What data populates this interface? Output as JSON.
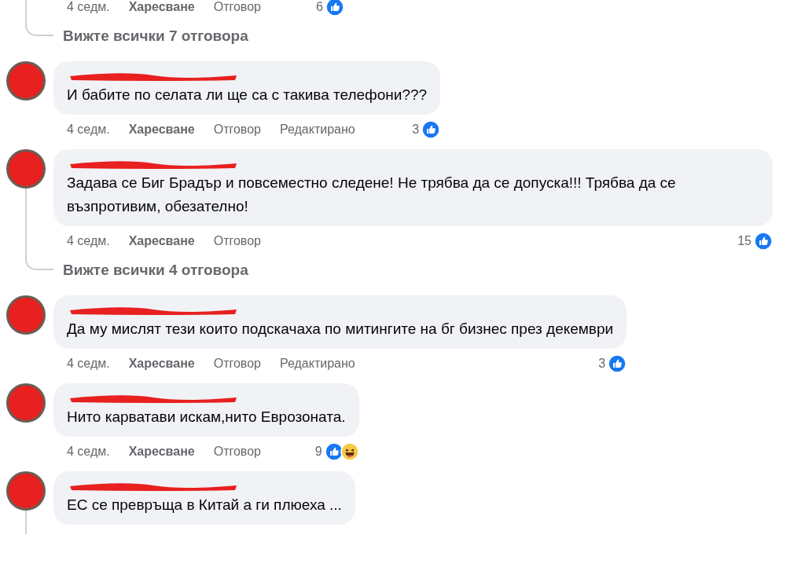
{
  "top_actions": {
    "time": "4 седм.",
    "like": "Харесване",
    "reply": "Отговор",
    "count": "6",
    "reactions": [
      {
        "kind": "like"
      }
    ]
  },
  "top_view_replies": "Вижте всички 7 отговора",
  "comments": [
    {
      "text": "И бабите по селата ли ще са с такива телефони???",
      "has_replies": false,
      "actions": {
        "time": "4 седм.",
        "like": "Харесване",
        "reply": "Отговор",
        "edited": "Редактирано",
        "count": "3",
        "reactions": [
          {
            "kind": "like"
          }
        ]
      }
    },
    {
      "text": "Задава се Биг Брадър и повсеместно следене! Не трябва да се допуска!!! Трябва да се възпротивим, обезателно!",
      "has_replies": true,
      "actions": {
        "time": "4 седм.",
        "like": "Харесване",
        "reply": "Отговор",
        "count": "15",
        "reactions": [
          {
            "kind": "like"
          }
        ]
      },
      "view_replies": "Вижте всички 4 отговора"
    },
    {
      "text": "Да му мислят тези които подскачаха по митингите на бг бизнес през декември",
      "has_replies": false,
      "actions": {
        "time": "4 седм.",
        "like": "Харесване",
        "reply": "Отговор",
        "edited": "Редактирано",
        "count": "3",
        "reactions": [
          {
            "kind": "like"
          }
        ]
      }
    },
    {
      "text": "Нито карватави искам,нито Еврозоната.",
      "has_replies": false,
      "actions": {
        "time": "4 седм.",
        "like": "Харесване",
        "reply": "Отговор",
        "count": "9",
        "reactions": [
          {
            "kind": "like"
          },
          {
            "kind": "haha"
          }
        ]
      }
    },
    {
      "text": "ЕС се превръща в Китай а ги плюеха ...",
      "has_replies": true
    }
  ]
}
